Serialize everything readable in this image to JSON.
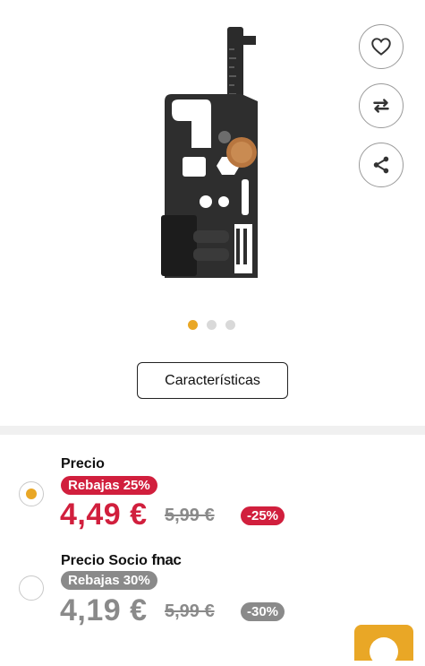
{
  "gallery": {
    "image_alt": "multi-tool card",
    "dots_count": 3,
    "active_dot": 0,
    "actions": [
      {
        "name": "wishlist",
        "icon": "heart-icon"
      },
      {
        "name": "compare",
        "icon": "compare-arrows-icon"
      },
      {
        "name": "share",
        "icon": "share-icon"
      }
    ]
  },
  "specs_button": "Características",
  "prices": {
    "standard": {
      "title": "Precio",
      "badge": "Rebajas 25%",
      "price": "4,49 €",
      "old_price": "5,99 €",
      "discount": "-25%",
      "selected": true
    },
    "member": {
      "title": "Precio Socio",
      "brand": "fnac",
      "badge": "Rebajas 30%",
      "price": "4,19 €",
      "old_price": "5,99 €",
      "discount": "-30%",
      "selected": false
    }
  },
  "colors": {
    "accent": "#e9a726",
    "sale_red": "#d11f3d",
    "member_grey": "#8a8a8a"
  }
}
